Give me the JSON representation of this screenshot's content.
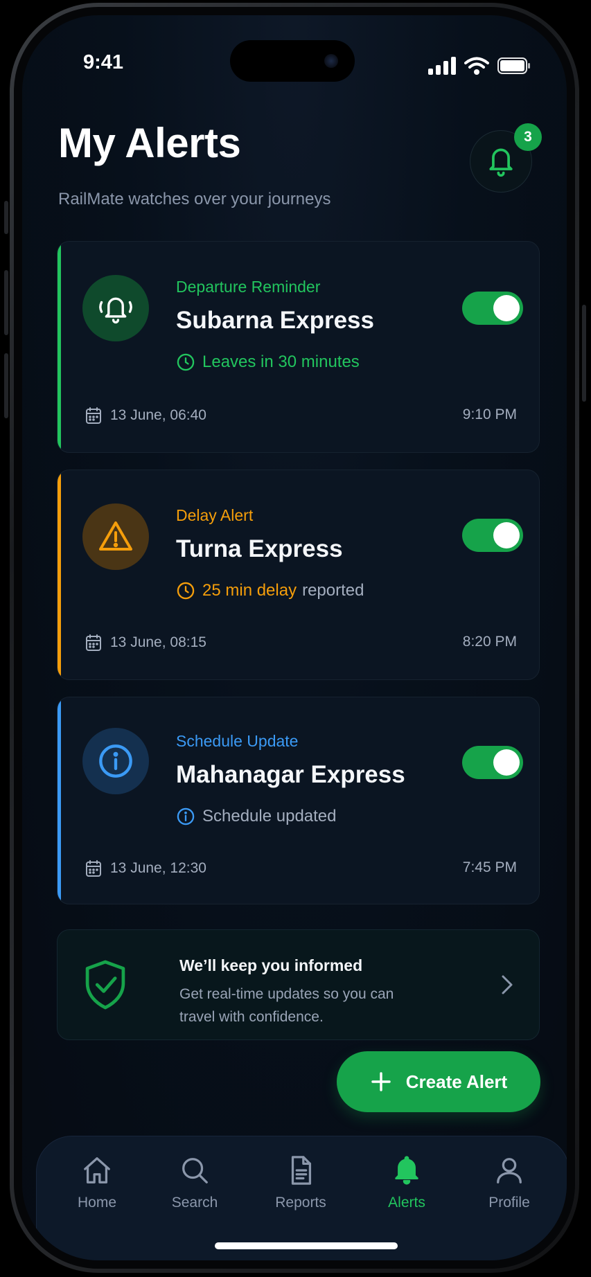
{
  "status_bar": {
    "time": "9:41"
  },
  "header": {
    "title": "My Alerts",
    "subtitle": "RailMate watches over your journeys",
    "notification_count": "3"
  },
  "alerts": [
    {
      "type": "Departure Reminder",
      "train": "Subarna Express",
      "status": "Leaves in 30 minutes",
      "status_suffix": "",
      "date": "13 June, 06:40",
      "time": "9:10 PM",
      "enabled": true,
      "color": "#22c55e"
    },
    {
      "type": "Delay Alert",
      "train": "Turna Express",
      "status": "25 min delay",
      "status_suffix": "reported",
      "date": "13 June, 08:15",
      "time": "8:20 PM",
      "enabled": true,
      "color": "#f59e0b"
    },
    {
      "type": "Schedule Update",
      "train": "Mahanagar Express",
      "status": "Schedule updated",
      "status_suffix": "",
      "date": "13 June, 12:30",
      "time": "7:45 PM",
      "enabled": true,
      "color": "#3b9af5"
    }
  ],
  "info_banner": {
    "title": "We’ll keep you informed",
    "description": "Get real-time updates so you can travel with confidence."
  },
  "create_button": {
    "label": "Create Alert"
  },
  "nav": [
    {
      "label": "Home",
      "icon": "home-icon"
    },
    {
      "label": "Search",
      "icon": "search-icon"
    },
    {
      "label": "Reports",
      "icon": "document-icon"
    },
    {
      "label": "Alerts",
      "icon": "bell-icon",
      "active": true
    },
    {
      "label": "Profile",
      "icon": "user-icon"
    }
  ],
  "colors": {
    "accent_green": "#16a34a",
    "warning": "#f59e0b",
    "info": "#3b9af5",
    "background": "#07101b"
  }
}
